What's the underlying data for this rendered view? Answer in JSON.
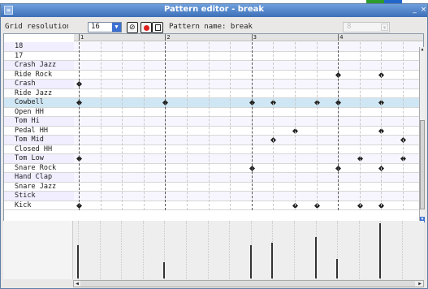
{
  "window": {
    "title": "Pattern editor - break"
  },
  "toolbar": {
    "grid_resolution_label": "Grid resolution",
    "grid_resolution_value": "16",
    "pattern_name_label": "Pattern name: break",
    "pattern_select_value": "8"
  },
  "icons": {
    "clear": "clear-pattern-icon",
    "record": "record-icon",
    "stop": "stop-icon",
    "dropdown": "chevron-down-icon",
    "close": "close-icon",
    "minimize": "minimize-icon"
  },
  "colors": {
    "titlebar": "#4a7cc4",
    "selected_row": "#cfe7f4",
    "record": "#e02020"
  },
  "ruler": {
    "beats": [
      "1",
      "2",
      "3",
      "4"
    ]
  },
  "grid": {
    "steps": 16,
    "selected_index": 6
  },
  "instruments": [
    {
      "name": "18",
      "notes": []
    },
    {
      "name": "17",
      "notes": []
    },
    {
      "name": "Crash Jazz",
      "notes": []
    },
    {
      "name": "Ride Rock",
      "notes": [
        12,
        14
      ]
    },
    {
      "name": "Crash",
      "notes": [
        0
      ]
    },
    {
      "name": "Ride Jazz",
      "notes": []
    },
    {
      "name": "Cowbell",
      "notes": [
        0,
        4,
        8,
        9,
        11,
        12,
        14
      ]
    },
    {
      "name": "Open HH",
      "notes": []
    },
    {
      "name": "Tom Hi",
      "notes": []
    },
    {
      "name": "Pedal HH",
      "notes": [
        10,
        14
      ]
    },
    {
      "name": "Tom Mid",
      "notes": [
        9,
        15
      ]
    },
    {
      "name": "Closed HH",
      "notes": []
    },
    {
      "name": "Tom Low",
      "notes": [
        0,
        13,
        15
      ]
    },
    {
      "name": "Snare Rock",
      "notes": [
        8,
        12,
        14
      ]
    },
    {
      "name": "Hand Clap",
      "notes": []
    },
    {
      "name": "Snare Jazz",
      "notes": []
    },
    {
      "name": "Stick",
      "notes": []
    },
    {
      "name": "Kick",
      "notes": [
        0,
        10,
        11,
        13,
        14
      ]
    }
  ],
  "velocity": {
    "bars": [
      [
        0,
        0.6
      ],
      [
        4,
        0.3
      ],
      [
        8,
        0.6
      ],
      [
        9,
        0.65
      ],
      [
        11,
        0.75
      ],
      [
        12,
        0.35
      ],
      [
        14,
        1.0
      ]
    ]
  }
}
